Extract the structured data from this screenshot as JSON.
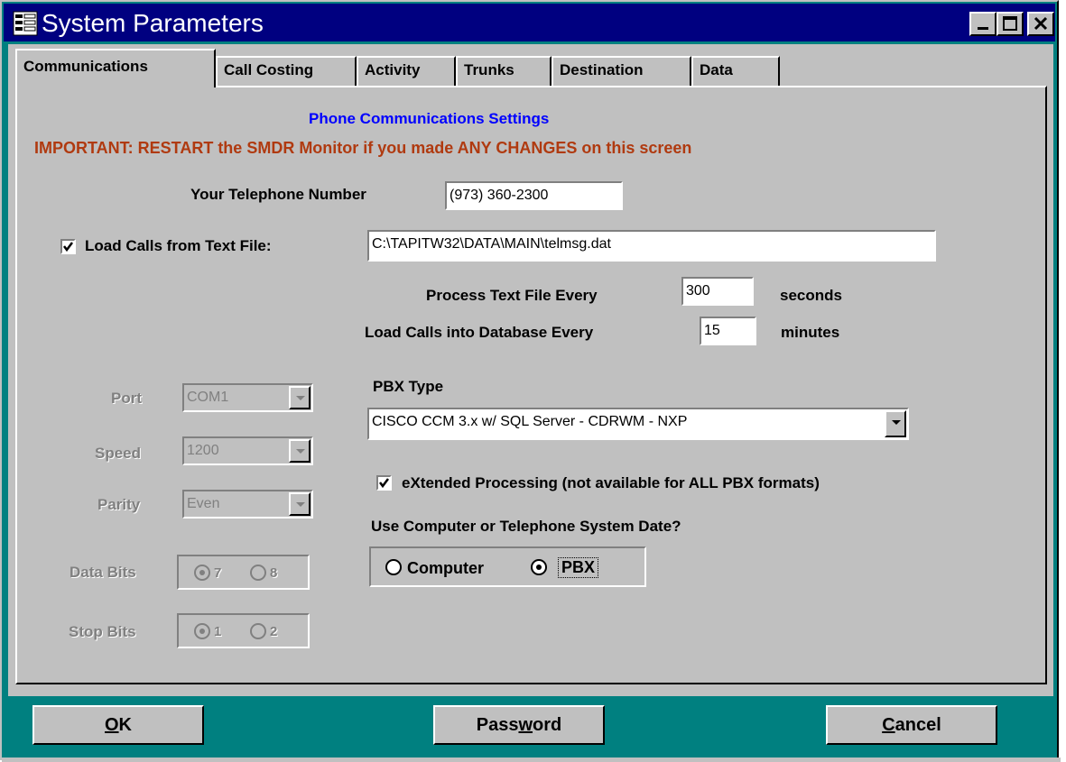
{
  "window": {
    "title": "System Parameters",
    "controls": [
      "minimize-icon",
      "maximize-icon",
      "close-icon"
    ]
  },
  "tabs": [
    {
      "label": "Communications",
      "active": true
    },
    {
      "label": "Call Costing",
      "active": false
    },
    {
      "label": "Activity",
      "active": false
    },
    {
      "label": "Trunks",
      "active": false
    },
    {
      "label": "Destination",
      "active": false
    },
    {
      "label": "Data",
      "active": false
    }
  ],
  "header": {
    "subtitle": "Phone Communications Settings",
    "warning": "IMPORTANT:  RESTART the SMDR Monitor if you made ANY CHANGES on this screen"
  },
  "colors": {
    "titlebar": "#000080",
    "subtitle": "#0000ff",
    "warning": "#b03a10",
    "frame": "#008080"
  },
  "phone": {
    "label": "Your Telephone Number",
    "value": "(973) 360-2300"
  },
  "load_calls": {
    "label": "Load Calls from Text File:",
    "checked": true,
    "path": "C:\\TAPITW32\\DATA\\MAIN\\telmsg.dat"
  },
  "process": {
    "label": "Process Text File Every",
    "value": "300",
    "unit": "seconds"
  },
  "load_db": {
    "label": "Load Calls into Database Every",
    "value": "15",
    "unit": "minutes"
  },
  "serial": {
    "port_label": "Port",
    "port_value": "COM1",
    "speed_label": "Speed",
    "speed_value": "1200",
    "parity_label": "Parity",
    "parity_value": "Even",
    "databits_label": "Data Bits",
    "databits_options": [
      "7",
      "8"
    ],
    "databits_selected": "7",
    "stopbits_label": "Stop Bits",
    "stopbits_options": [
      "1",
      "2"
    ],
    "stopbits_selected": "1"
  },
  "pbx": {
    "label": "PBX Type",
    "value": "CISCO CCM 3.x  w/ SQL Server - CDRWM - NXP"
  },
  "extended": {
    "label": "eXtended Processing  (not available for ALL PBX formats)",
    "checked": true
  },
  "date_source": {
    "question": "Use Computer or Telephone System Date?",
    "options": [
      "Computer",
      "PBX"
    ],
    "selected": "PBX"
  },
  "buttons": {
    "ok": {
      "pre": "",
      "ul": "O",
      "post": "K"
    },
    "password": {
      "pre": "Pass",
      "ul": "w",
      "post": "ord"
    },
    "cancel": {
      "pre": "",
      "ul": "C",
      "post": "ancel"
    }
  }
}
